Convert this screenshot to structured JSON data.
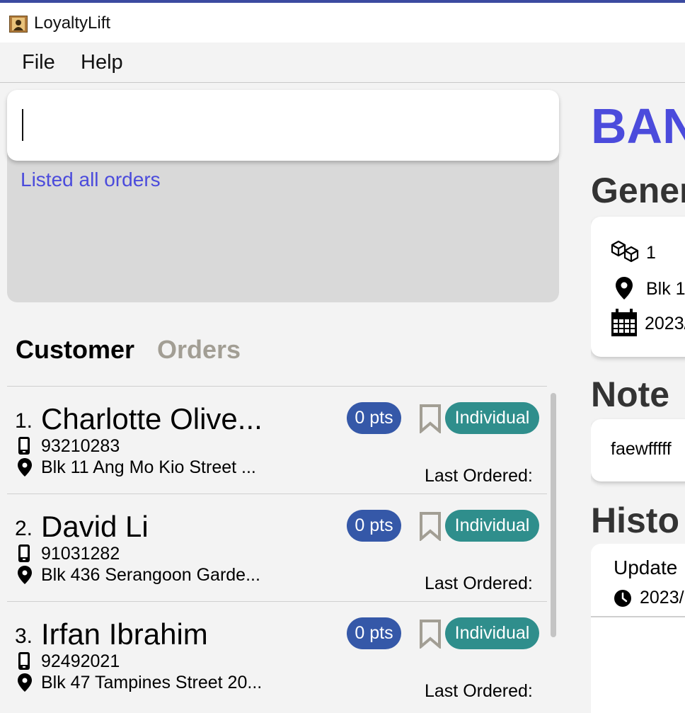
{
  "app": {
    "title": "LoyaltyLift"
  },
  "menu": {
    "file": "File",
    "help": "Help"
  },
  "command": {
    "value": "",
    "result": "Listed all orders"
  },
  "tabs": {
    "customer": "Customer",
    "orders": "Orders"
  },
  "customers": [
    {
      "index": "1.",
      "name": "Charlotte Olive...",
      "phone": "93210283",
      "address": "Blk 11 Ang Mo Kio Street ...",
      "points": "0 pts",
      "type": "Individual",
      "last_ordered": "Last Ordered:"
    },
    {
      "index": "2.",
      "name": "David Li",
      "phone": "91031282",
      "address": "Blk 436 Serangoon Garde...",
      "points": "0 pts",
      "type": "Individual",
      "last_ordered": "Last Ordered:"
    },
    {
      "index": "3.",
      "name": "Irfan Ibrahim",
      "phone": "92492021",
      "address": "Blk 47 Tampines Street 20...",
      "points": "0 pts",
      "type": "Individual",
      "last_ordered": "Last Ordered:"
    }
  ],
  "detail": {
    "title": "BAN",
    "general_heading": "Gener",
    "quantity": "1",
    "address": "Blk 1",
    "date": "2023/",
    "note_heading": "Note",
    "note_text": "faewfffff",
    "history_heading": "Histo",
    "history_status": "Update",
    "history_time": "2023/"
  },
  "colors": {
    "accent": "#4b4bdc",
    "points_badge": "#3558a8",
    "type_badge": "#2f8e8c",
    "inactive_tab": "#a29e94"
  },
  "icons": {
    "app": "person-icon",
    "phone": "phone-icon",
    "address": "location-pin-icon",
    "bookmark": "bookmark-icon",
    "quantity": "boxes-icon",
    "date": "calendar-icon",
    "time": "clock-icon"
  }
}
